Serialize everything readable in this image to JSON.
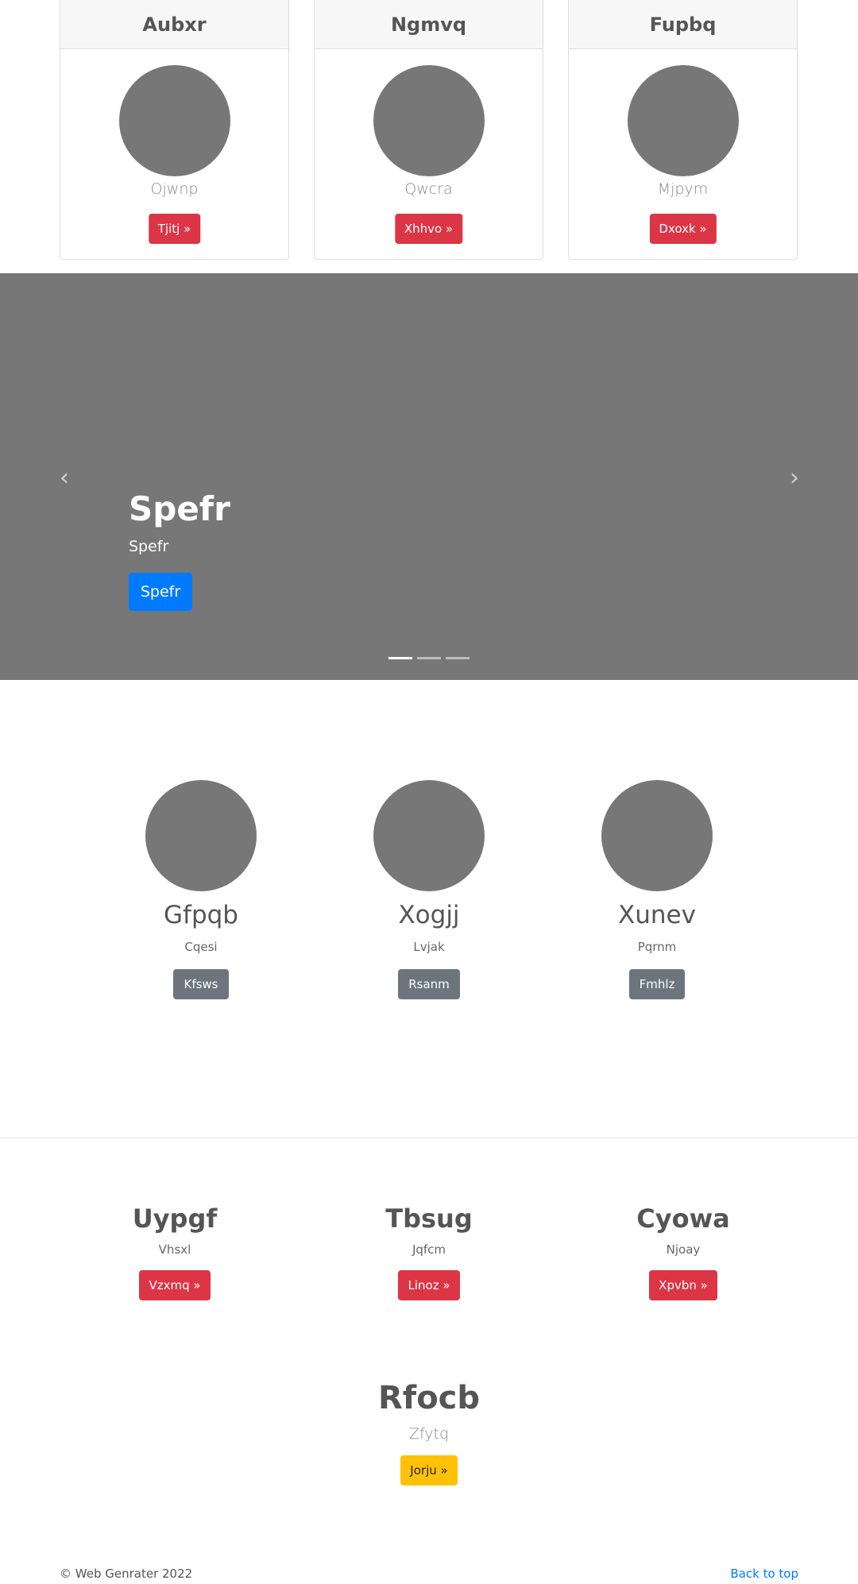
{
  "cards": [
    {
      "title": "Aubxr",
      "subtitle": "Ojwnp",
      "button": "Tjitj »"
    },
    {
      "title": "Ngmvq",
      "subtitle": "Qwcra",
      "button": "Xhhvo »"
    },
    {
      "title": "Fupbq",
      "subtitle": "Mjpym",
      "button": "Dxoxk »"
    }
  ],
  "carousel": {
    "title": "Spefr",
    "subtitle": "Spefr",
    "button": "Spefr",
    "prev_icon": "‹",
    "next_icon": "›",
    "slide_count": 3,
    "active_slide": 1
  },
  "profiles": [
    {
      "name": "Gfpqb",
      "subtitle": "Cqesi",
      "button": "Kfsws"
    },
    {
      "name": "Xogjj",
      "subtitle": "Lvjak",
      "button": "Rsanm"
    },
    {
      "name": "Xunev",
      "subtitle": "Pqrnm",
      "button": "Fmhlz"
    }
  ],
  "features": [
    {
      "title": "Uypgf",
      "subtitle": "Vhsxl",
      "button": "Vzxmq »"
    },
    {
      "title": "Tbsug",
      "subtitle": "Jqfcm",
      "button": "Linoz »"
    },
    {
      "title": "Cyowa",
      "subtitle": "Njoay",
      "button": "Xpvbn »"
    }
  ],
  "final": {
    "title": "Rfocb",
    "subtitle": "Zfytq",
    "button": "Jorju »"
  },
  "footer": {
    "copyright": "© Web Genrater 2022",
    "back_to_top": "Back to top"
  },
  "colors": {
    "placeholder_gray": "#777777",
    "danger": "#dc3545",
    "primary": "#007bff",
    "secondary": "#6c757d",
    "warning": "#ffc107"
  }
}
